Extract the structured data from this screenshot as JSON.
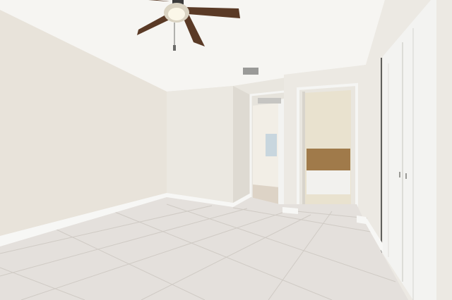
{
  "scene": {
    "description_hidden": "",
    "colors": {
      "ceiling": "#f6f5f2",
      "wall_left": "#e8e3da",
      "wall_back": "#ebe8e1",
      "wall_right": "#ece9e3",
      "floor": "#e4e0dc",
      "grout": "#cfcac4",
      "baseboard": "#f7f7f5",
      "fan_blade": "#5a3a26",
      "fan_housing": "#3b3b3b",
      "closet_door": "#f3f3f1",
      "tub_tile": "#a07a4a",
      "doorway_frame": "#f5f5f3",
      "vent": "#9a9a98"
    },
    "objects": [
      {
        "name": "ceiling-fan"
      },
      {
        "name": "air-vent"
      },
      {
        "name": "hallway-doorway"
      },
      {
        "name": "bathroom-doorway"
      },
      {
        "name": "bathtub"
      },
      {
        "name": "closet-door"
      },
      {
        "name": "tile-floor"
      }
    ]
  }
}
